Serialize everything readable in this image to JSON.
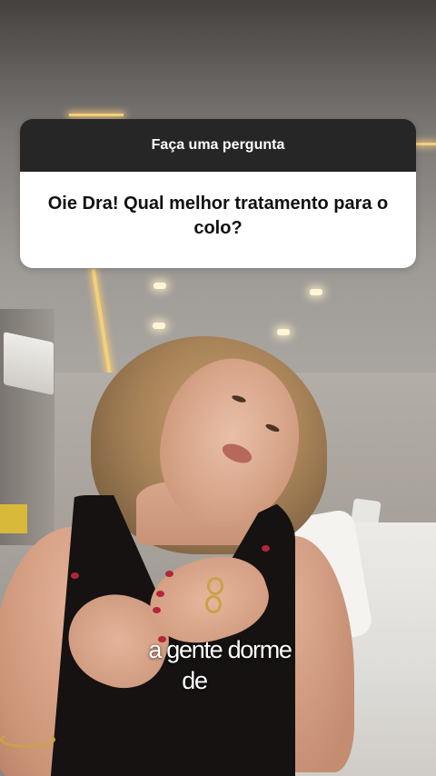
{
  "question_box": {
    "header": "Faça uma pergunta",
    "question": "Oie Dra! Qual melhor tratamento para o colo?"
  },
  "caption": {
    "line1": "a gente dorme",
    "line2": "de"
  }
}
